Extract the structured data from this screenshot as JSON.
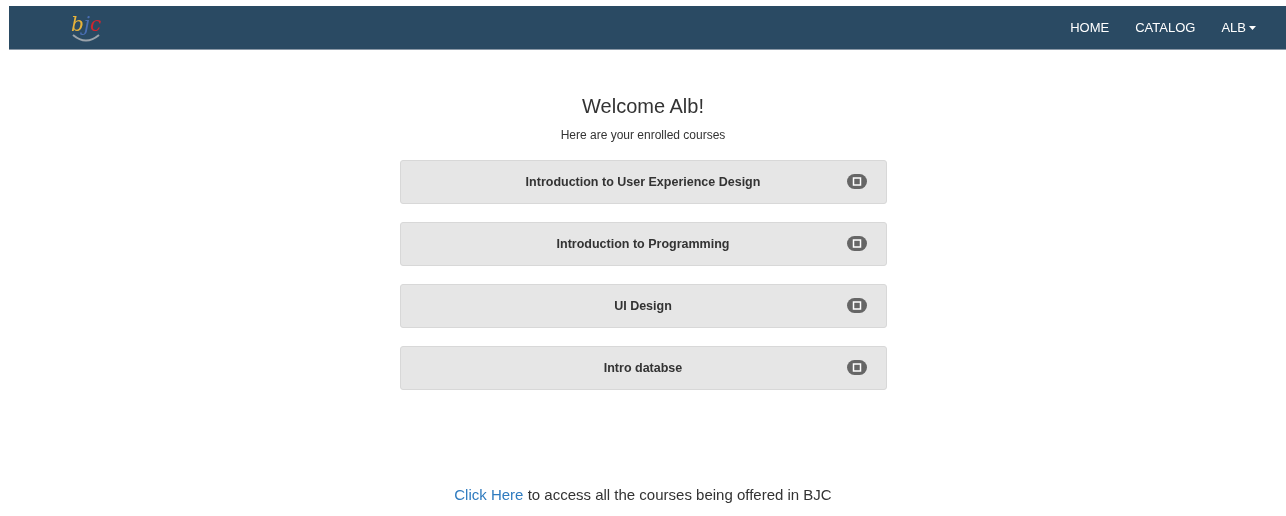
{
  "navbar": {
    "logo": [
      {
        "text": "b",
        "color": "#e8b33a"
      },
      {
        "text": "j",
        "color": "#4a6fb5"
      },
      {
        "text": "c",
        "color": "#d0262f"
      }
    ],
    "links": [
      {
        "label": "HOME",
        "kind": "link"
      },
      {
        "label": "CATALOG",
        "kind": "link"
      },
      {
        "label": "ALB",
        "kind": "dropdown"
      }
    ]
  },
  "heading": "Welcome Alb!",
  "subheading": "Here are your enrolled courses",
  "courses": [
    {
      "title": "Introduction to User Experience Design"
    },
    {
      "title": "Introduction to Programming"
    },
    {
      "title": "UI Design"
    },
    {
      "title": "Intro databse"
    }
  ],
  "footer": {
    "link": "Click Here",
    "text": "to access all the courses being offered in BJC"
  }
}
